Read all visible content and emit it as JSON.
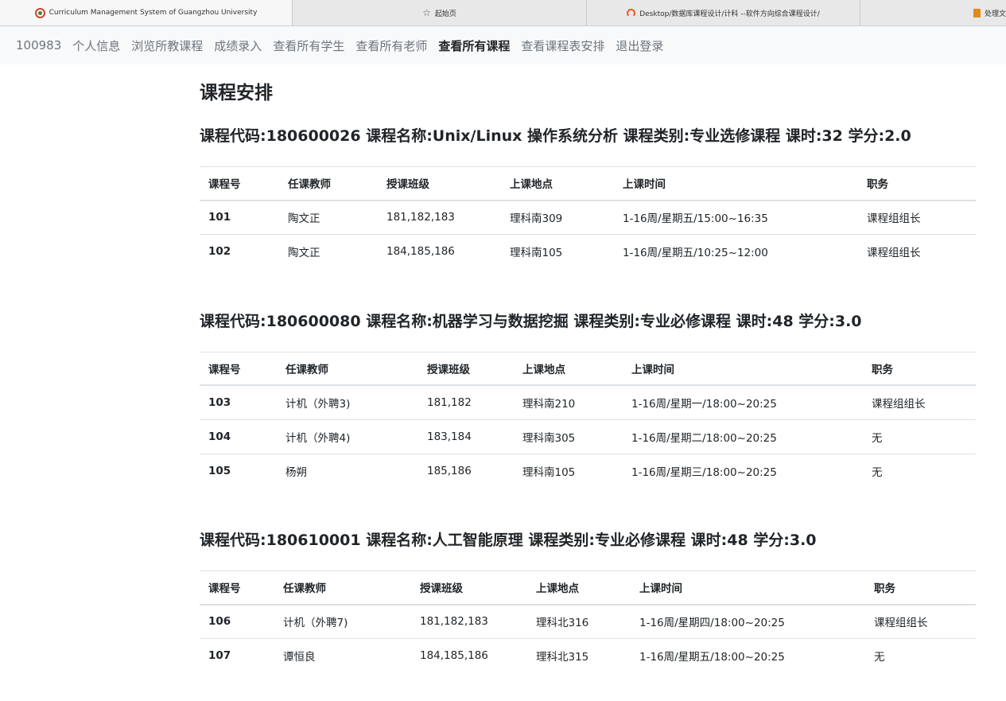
{
  "browser": {
    "tabs": [
      {
        "title": "Curriculum Management System of Guangzhou University",
        "icon": "university-logo-icon",
        "active": true
      },
      {
        "title": "起始页",
        "icon": "star-icon",
        "active": false
      },
      {
        "title": "Desktop/数据库课程设计/计科 --软件方向综合课程设计/",
        "icon": "loading-icon",
        "active": false
      },
      {
        "title": "处理文",
        "icon": "book-icon",
        "active": false
      }
    ]
  },
  "nav": {
    "user_id": "100983",
    "items": [
      "个人信息",
      "浏览所教课程",
      "成绩录入",
      "查看所有学生",
      "查看所有老师",
      "查看所有课程",
      "查看课程表安排",
      "退出登录"
    ],
    "active_index": 5
  },
  "page": {
    "title": "课程安排"
  },
  "courses": [
    {
      "heading": "课程代码:180600026 课程名称:Unix/Linux 操作系统分析 课程类别:专业选修课程 课时:32 学分:2.0",
      "headers": [
        "课程号",
        "任课教师",
        "授课班级",
        "上课地点",
        "上课时间",
        "职务"
      ],
      "rows": [
        [
          "101",
          "陶文正",
          "181,182,183",
          "理科南309",
          "1-16周/星期五/15:00~16:35",
          "课程组组长"
        ],
        [
          "102",
          "陶文正",
          "184,185,186",
          "理科南105",
          "1-16周/星期五/10:25~12:00",
          "课程组组长"
        ]
      ]
    },
    {
      "heading": "课程代码:180600080 课程名称:机器学习与数据挖掘 课程类别:专业必修课程 课时:48 学分:3.0",
      "headers": [
        "课程号",
        "任课教师",
        "授课班级",
        "上课地点",
        "上课时间",
        "职务"
      ],
      "rows": [
        [
          "103",
          "计机（外聘3)",
          "181,182",
          "理科南210",
          "1-16周/星期一/18:00~20:25",
          "课程组组长"
        ],
        [
          "104",
          "计机（外聘4)",
          "183,184",
          "理科南305",
          "1-16周/星期二/18:00~20:25",
          "无"
        ],
        [
          "105",
          "杨朔",
          "185,186",
          "理科南105",
          "1-16周/星期三/18:00~20:25",
          "无"
        ]
      ]
    },
    {
      "heading": "课程代码:180610001 课程名称:人工智能原理 课程类别:专业必修课程 课时:48 学分:3.0",
      "headers": [
        "课程号",
        "任课教师",
        "授课班级",
        "上课地点",
        "上课时间",
        "职务"
      ],
      "rows": [
        [
          "106",
          "计机（外聘7)",
          "181,182,183",
          "理科北316",
          "1-16周/星期四/18:00~20:25",
          "课程组组长"
        ],
        [
          "107",
          "谭恒良",
          "184,185,186",
          "理科北315",
          "1-16周/星期五/18:00~20:25",
          "无"
        ]
      ]
    }
  ]
}
